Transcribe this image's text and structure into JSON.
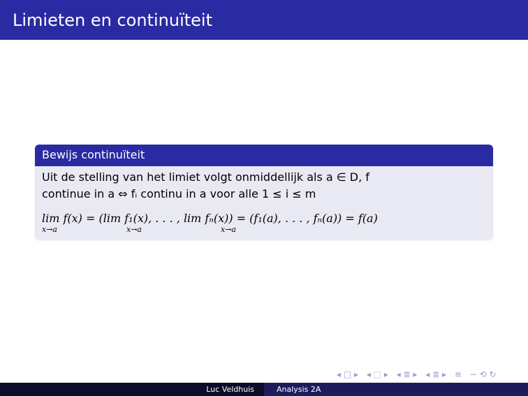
{
  "slide": {
    "title": "Limieten en continuïteit"
  },
  "block": {
    "title": "Bewijs continuïteit",
    "line1": "Uit de stelling van het limiet volgt onmiddellijk als a ∈ D, f",
    "line2": "continue in a ⇔ fᵢ continu in a voor alle 1 ≤ i ≤ m",
    "line3": "lim f(x) = (lim f₁(x), . . . , lim fₙ(x)) = (f₁(a), . . . , fₙ(a)) = f(a)",
    "lim_subscript": "x→a"
  },
  "navigation": {
    "symbols": [
      "◂ □ ▸",
      "◂ ⬚ ▸",
      "◂ ≣ ▸",
      "◂ ≣ ▸",
      "≡",
      "∽ ⟲ ↻"
    ]
  },
  "footer": {
    "author": "Luc Veldhuis",
    "course": "Analysis 2A"
  },
  "colors": {
    "primary": "#2a2aa2",
    "block_background": "#e9e9f4",
    "footer_dark": "#0c0c28",
    "footer_light": "#1c1c5c"
  }
}
